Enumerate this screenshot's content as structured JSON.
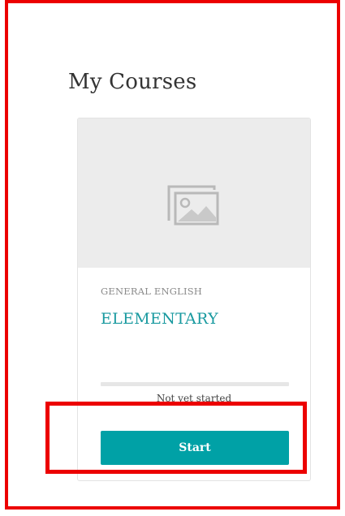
{
  "page": {
    "title": "My Courses"
  },
  "course_card": {
    "thumbnail_icon": "image-placeholder-icon",
    "category": "GENERAL ENGLISH",
    "name": "ELEMENTARY",
    "progress": 0,
    "status": "Not yet started",
    "start_label": "Start"
  },
  "colors": {
    "accent": "#00a1a6",
    "title_link": "#1a9aa0",
    "annotation": "#ec0000",
    "thumb_bg": "#ececec"
  }
}
